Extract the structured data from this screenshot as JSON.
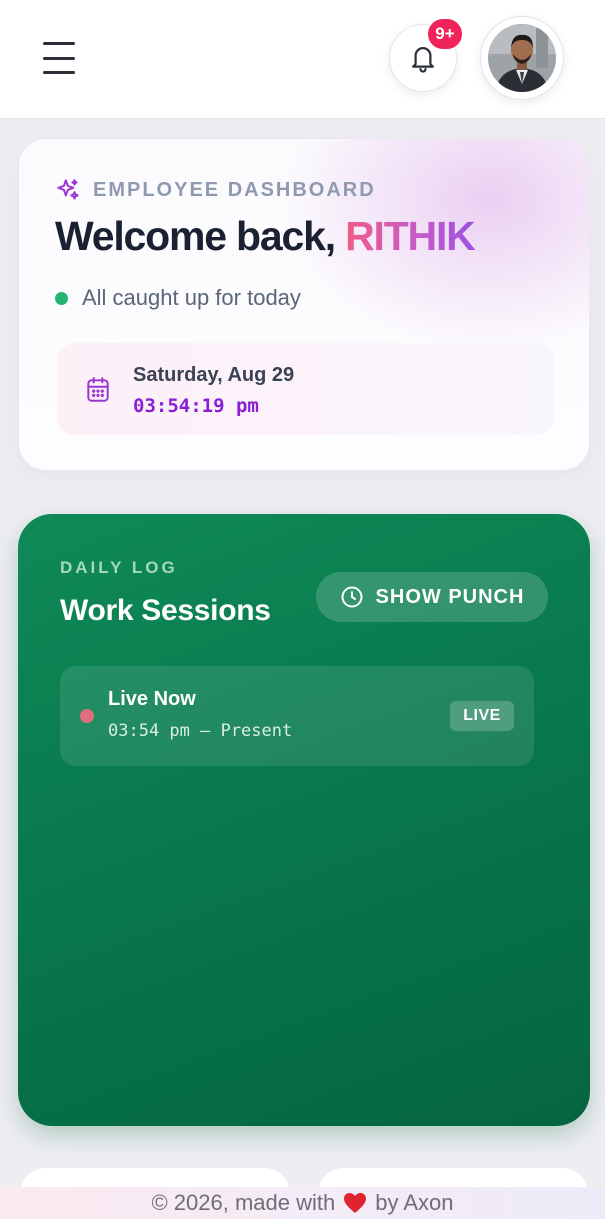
{
  "header": {
    "notification_count": "9+",
    "icons": {
      "menu": "menu-icon",
      "bell": "bell-icon"
    },
    "avatar_alt": "User avatar"
  },
  "welcome": {
    "eyebrow": "EMPLOYEE DASHBOARD",
    "greeting": "Welcome back, ",
    "name": "RITHIK",
    "status": "All caught up for today",
    "date": "Saturday, Aug 29",
    "time": "03:54:19 pm",
    "icons": {
      "eyebrow": "sparkles-icon",
      "date": "calendar-icon"
    }
  },
  "sessions": {
    "eyebrow": "DAILY LOG",
    "title": "Work Sessions",
    "punch_button": "SHOW PUNCH",
    "entries": [
      {
        "title": "Live Now",
        "range": "03:54 pm — Present",
        "badge": "LIVE"
      }
    ]
  },
  "footer": {
    "prefix": "© 2026, made with",
    "suffix": "by Axon"
  },
  "colors": {
    "accent_green": "#0f8a58",
    "badge_red": "#f0245a",
    "name_gradient_start": "#f25c86",
    "name_gradient_end": "#9b52e0",
    "time_purple": "#8a1fd6",
    "status_green": "#22b573"
  }
}
